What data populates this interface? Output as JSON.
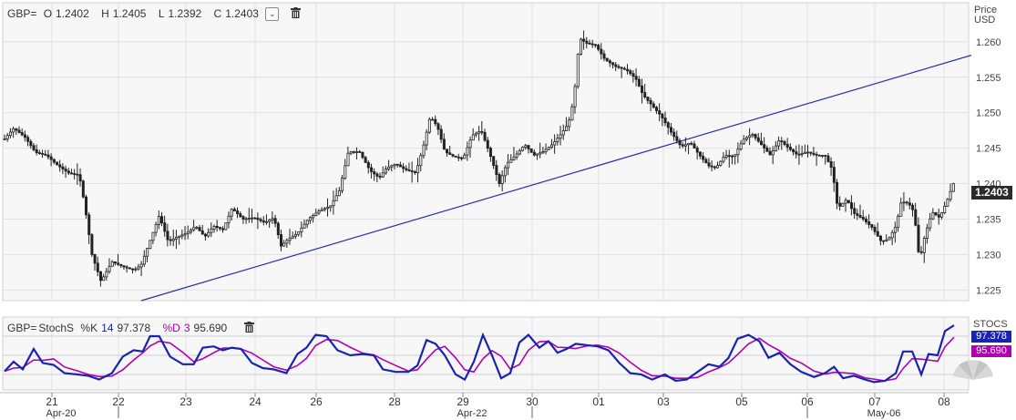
{
  "header": {
    "symbol": "GBP=",
    "open_label": "O",
    "open_value": "1.2402",
    "high_label": "H",
    "high_value": "1.2405",
    "low_label": "L",
    "low_value": "1.2392",
    "close_label": "C",
    "close_value": "1.2403",
    "dropdown_glyph": "⌄"
  },
  "price_axis": {
    "title_line1": "Price",
    "title_line2": "USD",
    "last_price": "1.2403"
  },
  "stoch_panel": {
    "symbol": "GBP=",
    "indicator": "StochS",
    "k_label": "%K",
    "k_period": "14",
    "k_value": "97.378",
    "d_label": "%D",
    "d_period": "3",
    "d_value": "95.690",
    "axis_title": "STOCS",
    "k_color": "#1a22b0",
    "d_color": "#b000b0"
  },
  "colors": {
    "candle": "#222222",
    "trendline": "#2b2fa8",
    "grid": "#e1e1e1",
    "plot_bg": "#f7f7f7"
  },
  "chart_data": {
    "type": "candlestick",
    "y_axis": {
      "ticks": [
        "1.225",
        "1.230",
        "1.235",
        "1.240",
        "1.245",
        "1.250",
        "1.255",
        "1.260"
      ],
      "ylim": [
        1.2235,
        1.2655
      ]
    },
    "x_axis": {
      "day_ticks": [
        "21",
        "22",
        "23",
        "24",
        "26",
        "28",
        "29",
        "30",
        "01",
        "03",
        "05",
        "06",
        "07",
        "08"
      ],
      "month_labels": [
        "Apr-20",
        "Apr-22",
        "May-06"
      ]
    },
    "price_path": [
      [
        0,
        1.2463
      ],
      [
        10,
        1.2478
      ],
      [
        22,
        1.2466
      ],
      [
        34,
        1.2444
      ],
      [
        46,
        1.244
      ],
      [
        58,
        1.2426
      ],
      [
        70,
        1.2415
      ],
      [
        82,
        1.2412
      ],
      [
        88,
        1.237
      ],
      [
        96,
        1.23
      ],
      [
        106,
        1.2262
      ],
      [
        118,
        1.229
      ],
      [
        130,
        1.2283
      ],
      [
        142,
        1.2278
      ],
      [
        150,
        1.2285
      ],
      [
        160,
        1.232
      ],
      [
        170,
        1.2355
      ],
      [
        180,
        1.2318
      ],
      [
        190,
        1.2325
      ],
      [
        200,
        1.233
      ],
      [
        210,
        1.234
      ],
      [
        220,
        1.2325
      ],
      [
        230,
        1.234
      ],
      [
        240,
        1.2335
      ],
      [
        250,
        1.2365
      ],
      [
        262,
        1.235
      ],
      [
        274,
        1.2352
      ],
      [
        286,
        1.2345
      ],
      [
        296,
        1.2352
      ],
      [
        304,
        1.2312
      ],
      [
        312,
        1.2322
      ],
      [
        322,
        1.233
      ],
      [
        334,
        1.235
      ],
      [
        346,
        1.2362
      ],
      [
        358,
        1.2368
      ],
      [
        368,
        1.239
      ],
      [
        378,
        1.2445
      ],
      [
        390,
        1.2445
      ],
      [
        402,
        1.2418
      ],
      [
        412,
        1.2408
      ],
      [
        420,
        1.2422
      ],
      [
        430,
        1.2428
      ],
      [
        440,
        1.242
      ],
      [
        452,
        1.2415
      ],
      [
        460,
        1.245
      ],
      [
        468,
        1.2495
      ],
      [
        476,
        1.248
      ],
      [
        484,
        1.2445
      ],
      [
        494,
        1.2438
      ],
      [
        504,
        1.2435
      ],
      [
        514,
        1.2468
      ],
      [
        524,
        1.2475
      ],
      [
        534,
        1.244
      ],
      [
        544,
        1.24
      ],
      [
        552,
        1.2428
      ],
      [
        562,
        1.244
      ],
      [
        572,
        1.2455
      ],
      [
        582,
        1.244
      ],
      [
        592,
        1.2445
      ],
      [
        602,
        1.2455
      ],
      [
        612,
        1.247
      ],
      [
        620,
        1.2485
      ],
      [
        626,
        1.252
      ],
      [
        632,
        1.2605
      ],
      [
        640,
        1.2598
      ],
      [
        650,
        1.2595
      ],
      [
        660,
        1.2575
      ],
      [
        672,
        1.2565
      ],
      [
        684,
        1.256
      ],
      [
        694,
        1.2548
      ],
      [
        702,
        1.2525
      ],
      [
        712,
        1.251
      ],
      [
        722,
        1.2495
      ],
      [
        734,
        1.247
      ],
      [
        744,
        1.2452
      ],
      [
        754,
        1.2458
      ],
      [
        764,
        1.244
      ],
      [
        774,
        1.2425
      ],
      [
        782,
        1.2422
      ],
      [
        792,
        1.244
      ],
      [
        802,
        1.2438
      ],
      [
        812,
        1.2462
      ],
      [
        822,
        1.247
      ],
      [
        832,
        1.2455
      ],
      [
        842,
        1.244
      ],
      [
        852,
        1.2462
      ],
      [
        862,
        1.245
      ],
      [
        872,
        1.244
      ],
      [
        882,
        1.2445
      ],
      [
        892,
        1.244
      ],
      [
        902,
        1.244
      ],
      [
        910,
        1.242
      ],
      [
        916,
        1.2365
      ],
      [
        926,
        1.2378
      ],
      [
        934,
        1.2358
      ],
      [
        944,
        1.235
      ],
      [
        954,
        1.2338
      ],
      [
        964,
        1.2318
      ],
      [
        972,
        1.2322
      ],
      [
        980,
        1.234
      ],
      [
        986,
        1.2375
      ],
      [
        994,
        1.2372
      ],
      [
        1000,
        1.236
      ],
      [
        1006,
        1.229
      ],
      [
        1012,
        1.2328
      ],
      [
        1020,
        1.236
      ],
      [
        1028,
        1.2352
      ],
      [
        1036,
        1.2375
      ],
      [
        1044,
        1.2403
      ]
    ],
    "trendline": {
      "from": [
        155,
        1.2235
      ],
      "to": [
        1066,
        1.2581
      ]
    },
    "stochastic": {
      "range": [
        0,
        100
      ],
      "k_path": [
        [
          0,
          25
        ],
        [
          10,
          40
        ],
        [
          20,
          28
        ],
        [
          32,
          60
        ],
        [
          42,
          38
        ],
        [
          54,
          35
        ],
        [
          66,
          22
        ],
        [
          80,
          20
        ],
        [
          92,
          18
        ],
        [
          104,
          12
        ],
        [
          118,
          22
        ],
        [
          130,
          48
        ],
        [
          142,
          58
        ],
        [
          152,
          56
        ],
        [
          160,
          80
        ],
        [
          170,
          80
        ],
        [
          182,
          48
        ],
        [
          196,
          36
        ],
        [
          208,
          36
        ],
        [
          218,
          62
        ],
        [
          230,
          64
        ],
        [
          240,
          58
        ],
        [
          250,
          62
        ],
        [
          260,
          60
        ],
        [
          272,
          38
        ],
        [
          284,
          30
        ],
        [
          296,
          28
        ],
        [
          310,
          22
        ],
        [
          322,
          52
        ],
        [
          332,
          62
        ],
        [
          342,
          82
        ],
        [
          354,
          80
        ],
        [
          366,
          58
        ],
        [
          380,
          50
        ],
        [
          394,
          52
        ],
        [
          406,
          50
        ],
        [
          416,
          28
        ],
        [
          430,
          24
        ],
        [
          444,
          24
        ],
        [
          454,
          34
        ],
        [
          464,
          74
        ],
        [
          474,
          68
        ],
        [
          484,
          50
        ],
        [
          496,
          20
        ],
        [
          506,
          12
        ],
        [
          516,
          40
        ],
        [
          526,
          82
        ],
        [
          536,
          50
        ],
        [
          546,
          14
        ],
        [
          556,
          22
        ],
        [
          566,
          70
        ],
        [
          576,
          82
        ],
        [
          588,
          62
        ],
        [
          598,
          72
        ],
        [
          608,
          54
        ],
        [
          618,
          60
        ],
        [
          628,
          68
        ],
        [
          640,
          66
        ],
        [
          652,
          64
        ],
        [
          664,
          58
        ],
        [
          676,
          38
        ],
        [
          688,
          22
        ],
        [
          700,
          20
        ],
        [
          712,
          12
        ],
        [
          726,
          20
        ],
        [
          738,
          10
        ],
        [
          750,
          12
        ],
        [
          762,
          24
        ],
        [
          774,
          36
        ],
        [
          786,
          32
        ],
        [
          796,
          46
        ],
        [
          806,
          76
        ],
        [
          818,
          82
        ],
        [
          830,
          72
        ],
        [
          840,
          46
        ],
        [
          852,
          54
        ],
        [
          864,
          36
        ],
        [
          876,
          24
        ],
        [
          890,
          16
        ],
        [
          902,
          22
        ],
        [
          912,
          32
        ],
        [
          922,
          14
        ],
        [
          934,
          18
        ],
        [
          946,
          12
        ],
        [
          956,
          8
        ],
        [
          968,
          10
        ],
        [
          980,
          22
        ],
        [
          988,
          56
        ],
        [
          998,
          56
        ],
        [
          1008,
          20
        ],
        [
          1016,
          52
        ],
        [
          1026,
          50
        ],
        [
          1034,
          88
        ],
        [
          1044,
          97
        ]
      ]
    }
  }
}
